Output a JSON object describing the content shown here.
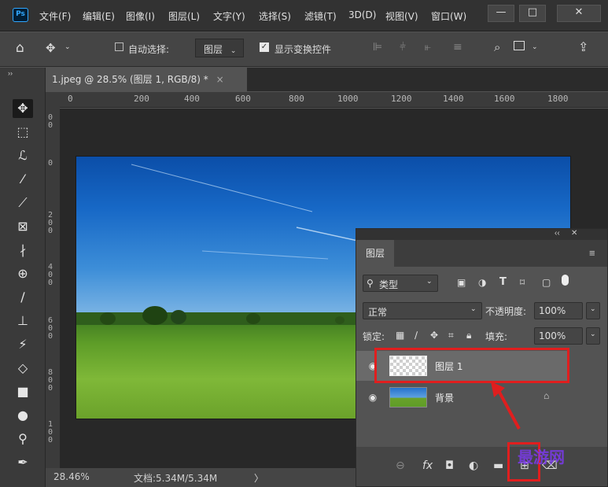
{
  "app": {
    "logo": "Ps",
    "menus": [
      "文件(F)",
      "编辑(E)",
      "图像(I)",
      "图层(L)",
      "文字(Y)",
      "选择(S)",
      "滤镜(T)",
      "3D(D)",
      "视图(V)",
      "窗口(W)"
    ],
    "window_controls": [
      "—",
      "□",
      "✕"
    ]
  },
  "options_bar": {
    "auto_select_label": "自动选择:",
    "auto_select_target": "图层",
    "show_transform_label": "显示变换控件"
  },
  "document": {
    "tab_title": "1.jpeg @ 28.5% (图层 1, RGB/8) *",
    "tab_close": "×",
    "ruler_marks": [
      "0",
      "200",
      "400",
      "600",
      "800",
      "1000",
      "1200",
      "1400",
      "1600",
      "1800"
    ],
    "vertical_marks": [
      "0\n0",
      "0",
      "2\n0\n0",
      "4\n0\n0",
      "6\n0\n0",
      "8\n0\n0",
      "1\n0\n0"
    ]
  },
  "status": {
    "zoom": "28.46%",
    "doc_size": "文档:5.34M/5.34M",
    "arrow": "〉"
  },
  "layers_panel": {
    "collapse": "‹‹",
    "close": "✕",
    "tab_label": "图层",
    "filter_label": "类型",
    "blend_mode": "正常",
    "opacity_label": "不透明度:",
    "opacity_value": "100%",
    "lock_label": "锁定:",
    "fill_label": "填充:",
    "fill_value": "100%",
    "layers": [
      {
        "name": "图层 1",
        "selected": true,
        "visible": true
      },
      {
        "name": "背景",
        "selected": false,
        "visible": true,
        "locked": true
      }
    ]
  },
  "watermark": "最游网",
  "colors": {
    "highlight": "#e01e1e",
    "ps_blue": "#31a8ff",
    "panel_bg": "#535353"
  }
}
